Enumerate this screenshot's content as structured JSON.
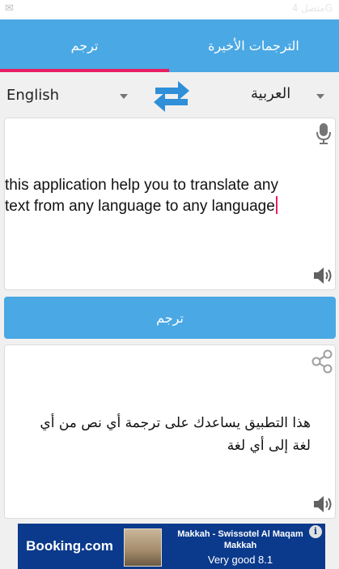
{
  "status_bar": {
    "text": "متصل 4G"
  },
  "tabs": [
    {
      "label": "ترجم",
      "active": true
    },
    {
      "label": "الترجمات الأخيرة",
      "active": false
    }
  ],
  "languages": {
    "source": "English",
    "target": "العربية"
  },
  "input": {
    "text": "this application help you to translate any text from any language to any language"
  },
  "translate_button": {
    "label": "ترجم"
  },
  "output": {
    "text": "هذا التطبيق يساعدك على ترجمة أي نص من أي لغة إلى أي لغة"
  },
  "ad": {
    "brand": "Booking",
    "brand_suffix": ".com",
    "title": "Makkah - Swissotel Al Maqam Makkah",
    "rating": "Very good 8.1",
    "info_glyph": "i"
  },
  "colors": {
    "primary": "#4aa8e4",
    "accent": "#e91e63",
    "ad_background": "#0b3a8c"
  },
  "icons": [
    "swap-icon",
    "microphone-icon",
    "speaker-icon",
    "share-icon",
    "info-icon",
    "dropdown-caret-icon"
  ]
}
